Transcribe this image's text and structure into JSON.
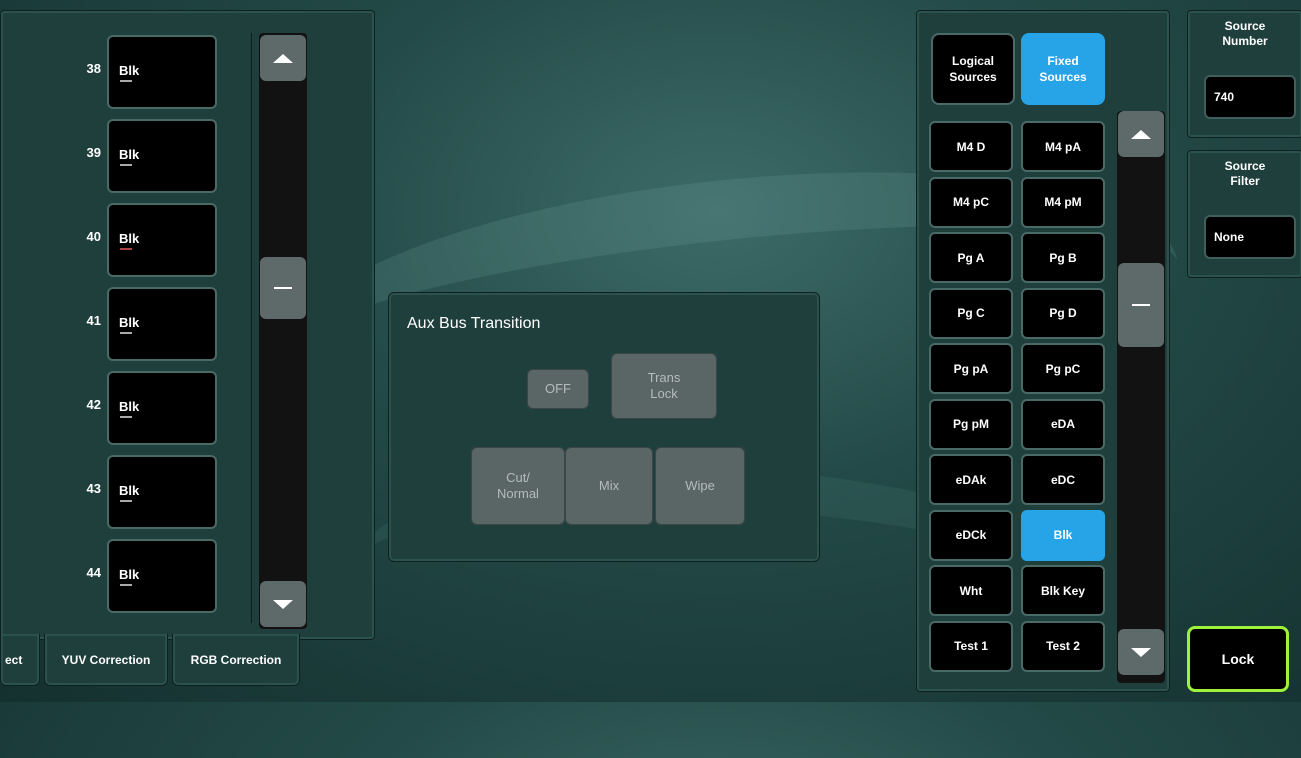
{
  "left_list": {
    "rows": [
      {
        "num": "38",
        "name": "Blk",
        "dash": "white"
      },
      {
        "num": "39",
        "name": "Blk",
        "dash": "white"
      },
      {
        "num": "40",
        "name": "Blk",
        "dash": "red"
      },
      {
        "num": "41",
        "name": "Blk",
        "dash": "white"
      },
      {
        "num": "42",
        "name": "Blk",
        "dash": "white"
      },
      {
        "num": "43",
        "name": "Blk",
        "dash": "white"
      },
      {
        "num": "44",
        "name": "Blk",
        "dash": "white"
      }
    ]
  },
  "tabs": [
    {
      "label": "ect"
    },
    {
      "label": "YUV Correction"
    },
    {
      "label": "RGB Correction"
    }
  ],
  "aux": {
    "title": "Aux Bus Transition",
    "off_label": "OFF",
    "trans_lock_label": "Trans\nLock",
    "cut_label": "Cut/\nNormal",
    "mix_label": "Mix",
    "wipe_label": "Wipe"
  },
  "sources": {
    "logical_label": "Logical\nSources",
    "fixed_label": "Fixed\nSources",
    "selected_mode": "fixed",
    "selected_color": "#27a4e8",
    "items": [
      "M4 D",
      "M4 pA",
      "M4 pC",
      "M4 pM",
      "Pg A",
      "Pg B",
      "Pg C",
      "Pg D",
      "Pg pA",
      "Pg pC",
      "Pg pM",
      "eDA",
      "eDAk",
      "eDC",
      "eDCk",
      "Blk",
      "Wht",
      "Blk Key",
      "Test 1",
      "Test 2"
    ],
    "selected_item": "Blk"
  },
  "source_number": {
    "label": "Source\nNumber",
    "value": "740"
  },
  "source_filter": {
    "label": "Source\nFilter",
    "value": "None"
  },
  "lock": {
    "label": "Lock",
    "accent": "#9ef23a"
  }
}
